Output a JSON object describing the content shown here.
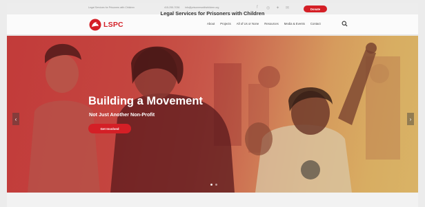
{
  "topbar": {
    "tagline": "Legal Services for Prisoners with Children",
    "phone": "415-255-7036",
    "email": "info@prisonerswithchildren.org",
    "social_icons": [
      "facebook-icon",
      "instagram-icon",
      "twitter-icon",
      "email-icon"
    ],
    "donate_label": "Donate"
  },
  "header": {
    "logo_text": "LSPC",
    "nav": [
      "About",
      "Projects",
      "All of Us or None",
      "Resources",
      "Media & Events",
      "Contact"
    ]
  },
  "hero": {
    "title": "Building a Movement",
    "subtitle": "Not Just Another Non-Profit",
    "cta_label": "Get Involved",
    "prev_arrow": "‹",
    "next_arrow": "›",
    "slides_total": 2,
    "slide_active": 1
  },
  "section": {
    "heading": "Legal Services for Prisoners with Children"
  },
  "colors": {
    "brand_red": "#d41f26",
    "hero_overlay_left": "#c23b3a",
    "hero_overlay_right": "#d9b366"
  }
}
